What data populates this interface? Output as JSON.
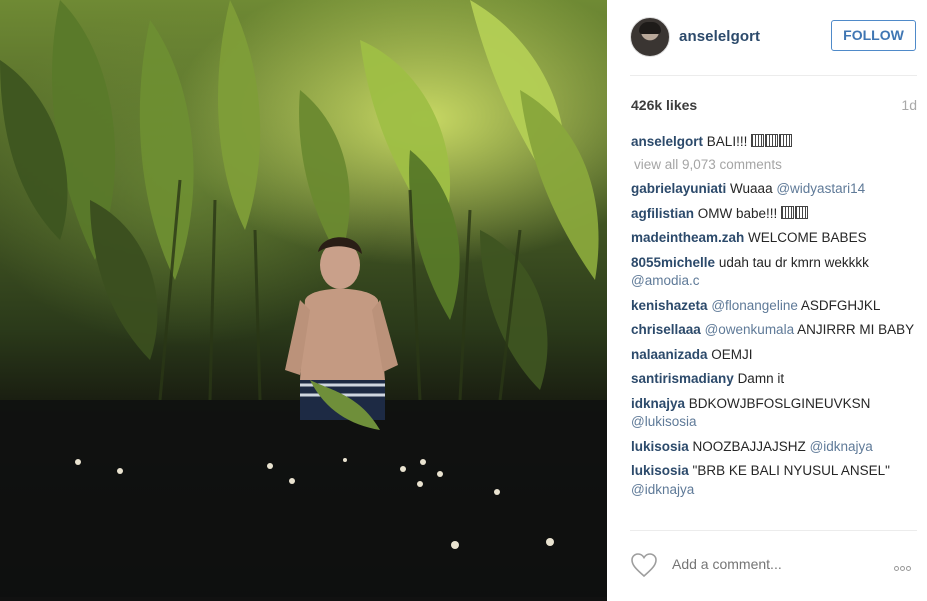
{
  "post": {
    "username": "anselelgort",
    "follow_label": "FOLLOW",
    "likes": "426k likes",
    "age": "1d",
    "caption": {
      "user": "anselelgort",
      "text": "BALI!!!"
    },
    "view_all": "view all 9,073 comments",
    "comments": [
      {
        "user": "gabrielayuniati",
        "text": "Wuaaa",
        "mention": "@widyastari14",
        "after": ""
      },
      {
        "user": "agfilistian",
        "text": "OMW babe!!!",
        "mention": "",
        "after": ""
      },
      {
        "user": "madeintheam.zah",
        "text": "WELCOME BABES",
        "mention": "",
        "after": ""
      },
      {
        "user": "8055michelle",
        "text": "udah tau dr kmrn wekkkk",
        "mention": "@amodia.c",
        "after": ""
      },
      {
        "user": "kenishazeta",
        "text": "",
        "mention": "@flonangeline",
        "after": "ASDFGHJKL"
      },
      {
        "user": "chrisellaaa",
        "text": "",
        "mention": "@owenkumala",
        "after": "ANJIRRR MI BABY"
      },
      {
        "user": "nalaanizada",
        "text": "OEMJI",
        "mention": "",
        "after": ""
      },
      {
        "user": "santirismadiany",
        "text": "Damn it",
        "mention": "",
        "after": ""
      },
      {
        "user": "idknajya",
        "text": "BDKOWJBFOSLGINEUVKSN",
        "mention": "@lukisosia",
        "after": ""
      },
      {
        "user": "lukisosia",
        "text": "NOOZBAJJAJSHZ",
        "mention": "@idknajya",
        "after": ""
      },
      {
        "user": "lukisosia",
        "text": "\"BRB KE BALI NYUSUL ANSEL\"",
        "mention": "@idknajya",
        "after": ""
      }
    ],
    "comment_placeholder": "Add a comment...",
    "icons": {
      "like": "heart-icon",
      "more": "more-options-icon"
    },
    "colors": {
      "username": "#2c4a6b",
      "follow": "#3f76b3",
      "muted": "#a5a5a5"
    }
  }
}
